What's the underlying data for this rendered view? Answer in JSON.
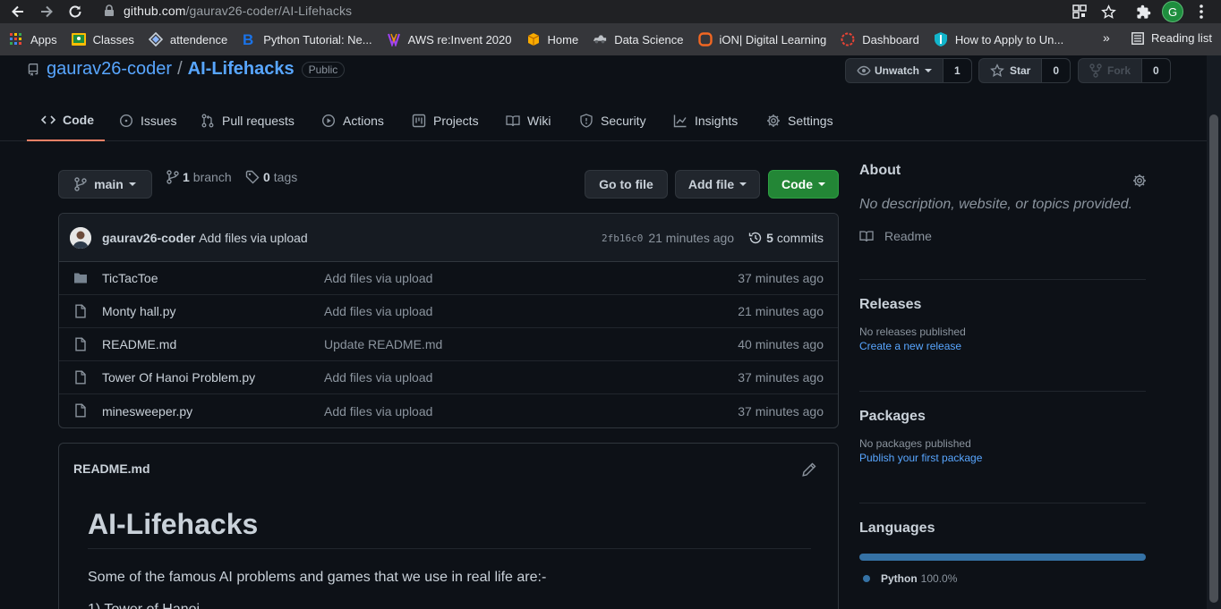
{
  "browser": {
    "url_host": "github.com",
    "url_path": "/gaurav26-coder/AI-Lifehacks",
    "profile_initial": "G",
    "bookmarks": [
      {
        "label": "Apps",
        "icon": "apps-grid-icon"
      },
      {
        "label": "Classes",
        "icon": "classroom-icon"
      },
      {
        "label": "attendence",
        "icon": "diamond-icon"
      },
      {
        "label": "Python Tutorial: Ne...",
        "icon": "b-logo-icon"
      },
      {
        "label": "AWS re:Invent 2020",
        "icon": "aws-icon"
      },
      {
        "label": "Home",
        "icon": "box-icon"
      },
      {
        "label": "Data Science",
        "icon": "car-icon"
      },
      {
        "label": "iON| Digital Learning",
        "icon": "ion-icon"
      },
      {
        "label": "Dashboard",
        "icon": "dashboard-icon"
      },
      {
        "label": "How to Apply to Un...",
        "icon": "shield-bookmark-icon"
      }
    ],
    "more": "»",
    "reading_list": "Reading list"
  },
  "repo": {
    "owner": "gaurav26-coder",
    "separator": "/",
    "name": "AI-Lifehacks",
    "visibility": "Public",
    "unwatch_label": "Unwatch",
    "watch_count": "1",
    "star_label": "Star",
    "star_count": "0",
    "fork_label": "Fork",
    "fork_count": "0"
  },
  "tabs": [
    {
      "label": "Code",
      "icon": "code-icon",
      "active": true
    },
    {
      "label": "Issues",
      "icon": "issue-icon"
    },
    {
      "label": "Pull requests",
      "icon": "pull-request-icon"
    },
    {
      "label": "Actions",
      "icon": "play-icon"
    },
    {
      "label": "Projects",
      "icon": "project-icon"
    },
    {
      "label": "Wiki",
      "icon": "book-icon"
    },
    {
      "label": "Security",
      "icon": "shield-icon"
    },
    {
      "label": "Insights",
      "icon": "graph-icon"
    },
    {
      "label": "Settings",
      "icon": "gear-icon"
    }
  ],
  "toolbar": {
    "branch": "main",
    "branch_count": "1",
    "branch_label": "branch",
    "tag_count": "0",
    "tag_label": "tags",
    "go_to_file": "Go to file",
    "add_file": "Add file",
    "code": "Code"
  },
  "commit": {
    "author": "gaurav26-coder",
    "message": "Add files via upload",
    "sha": "2fb16c0",
    "age": "21 minutes ago",
    "commit_count": "5",
    "commit_label": "commits"
  },
  "files": [
    {
      "name": "TicTacToe",
      "type": "folder",
      "message": "Add files via upload",
      "age": "37 minutes ago"
    },
    {
      "name": "Monty hall.py",
      "type": "file",
      "message": "Add files via upload",
      "age": "21 minutes ago"
    },
    {
      "name": "README.md",
      "type": "file",
      "message": "Update README.md",
      "age": "40 minutes ago"
    },
    {
      "name": "Tower Of Hanoi Problem.py",
      "type": "file",
      "message": "Add files via upload",
      "age": "37 minutes ago"
    },
    {
      "name": "minesweeper.py",
      "type": "file",
      "message": "Add files via upload",
      "age": "37 minutes ago"
    }
  ],
  "readme": {
    "filename": "README.md",
    "title": "AI-Lifehacks",
    "paragraph": "Some of the famous AI problems and games that we use in real life are:-",
    "list_item_partial": "1) Tower of Hanoi"
  },
  "sidebar": {
    "about_title": "About",
    "about_desc": "No description, website, or topics provided.",
    "readme_label": "Readme",
    "releases_title": "Releases",
    "releases_none": "No releases published",
    "releases_link": "Create a new release",
    "packages_title": "Packages",
    "packages_none": "No packages published",
    "packages_link": "Publish your first package",
    "languages_title": "Languages",
    "language_name": "Python",
    "language_pct": "100.0%",
    "language_color": "#3572A5"
  },
  "colors": {
    "page_bg": "#0d1117",
    "link": "#58a6ff",
    "green_button": "#238636",
    "active_tab_underline": "#f78166"
  }
}
